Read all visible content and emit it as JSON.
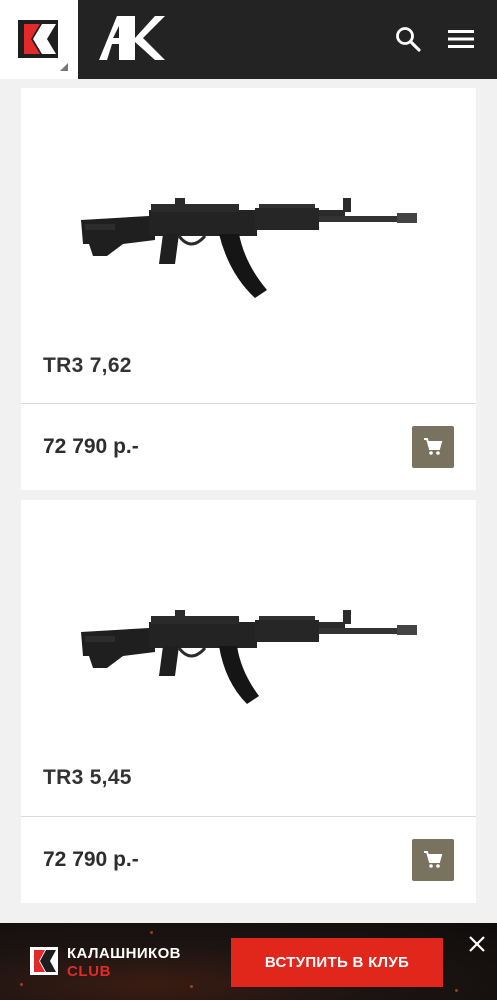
{
  "header": {
    "logo_name": "kalashnikov-k-logo",
    "brand_name": "ak-brand-logo",
    "search_icon": "search-icon",
    "menu_icon": "menu-icon"
  },
  "products": [
    {
      "name": "TR3 7,62",
      "price": "72 790 р.-",
      "cart_icon": "cart-icon"
    },
    {
      "name": "TR3 5,45",
      "price": "72 790 р.-",
      "cart_icon": "cart-icon"
    }
  ],
  "banner": {
    "title": "КАЛАШНИКОВ",
    "subtitle": "CLUB",
    "cta_label": "ВСТУПИТЬ В КЛУБ",
    "close_icon": "close-icon"
  },
  "colors": {
    "header_bg": "#232323",
    "cart_button": "#78725f",
    "cta": "#e1261c",
    "brand_red": "#e22a2a"
  }
}
